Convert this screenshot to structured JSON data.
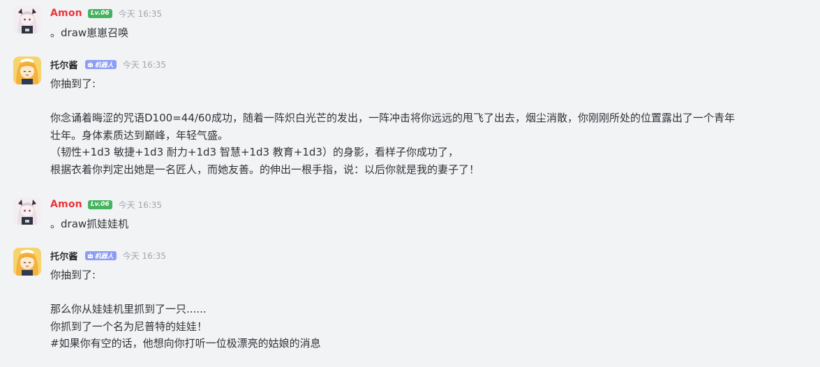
{
  "colors": {
    "background": "#f2f3f5",
    "amon_name": "#e8353b",
    "bot_name": "#2b2d31",
    "level_badge": "#45b35f",
    "bot_badge": "#8b9df5",
    "timestamp": "#a3a6ad",
    "text": "#313338"
  },
  "messages": [
    {
      "author": "Amon",
      "badge": "Lv.06",
      "time": "今天 16:35",
      "lines": [
        "。draw崽崽召唤"
      ]
    },
    {
      "author": "托尔酱",
      "badge": "机器人",
      "time": "今天 16:35",
      "lines": [
        "你抽到了:",
        "",
        "你念诵着晦涩的咒语D100=44/60成功，随着一阵炽白光芒的发出，一阵冲击将你远远的甩飞了出去，烟尘消散，你刚刚所处的位置露出了一个青年",
        "壮年。身体素质达到巅峰，年轻气盛。",
        "（韧性+1d3 敏捷+1d3 耐力+1d3 智慧+1d3 教育+1d3）的身影，看样子你成功了，",
        "根据衣着你判定出她是一名匠人，而她友善。的伸出一根手指，说：以后你就是我的妻子了！"
      ]
    },
    {
      "author": "Amon",
      "badge": "Lv.06",
      "time": "今天 16:35",
      "lines": [
        "。draw抓娃娃机"
      ]
    },
    {
      "author": "托尔酱",
      "badge": "机器人",
      "time": "今天 16:35",
      "lines": [
        "你抽到了:",
        "",
        "那么你从娃娃机里抓到了一只......",
        "你抓到了一个名为尼普特的娃娃！",
        "#如果你有空的话，他想向你打听一位极漂亮的姑娘的消息"
      ]
    }
  ]
}
